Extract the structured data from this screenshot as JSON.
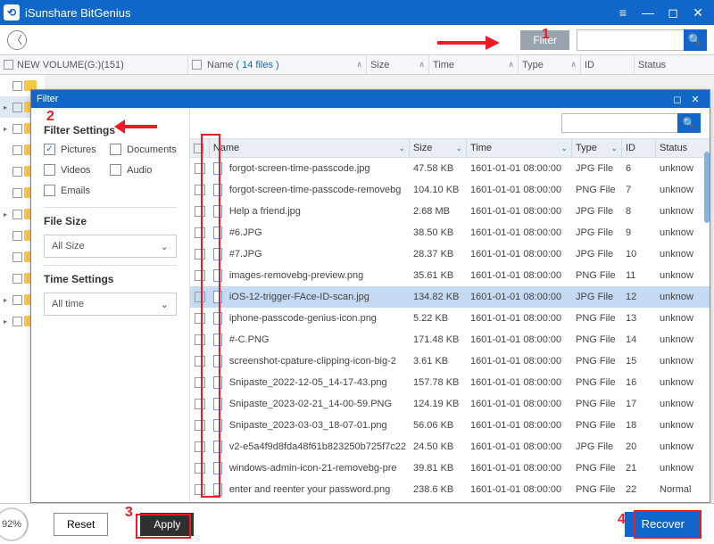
{
  "app_title": "iSunshare BitGenius",
  "topbar": {
    "filter_label": "Filter",
    "search_placeholder": ""
  },
  "main_header": {
    "volume": "NEW VOLUME(G:)(151)",
    "name_label": "Name",
    "name_count": "( 14 files )",
    "size": "Size",
    "time": "Time",
    "type": "Type",
    "id": "ID",
    "status": "Status"
  },
  "filter_panel": {
    "title": "Filter",
    "settings_heading": "Filter Settings",
    "types": {
      "pictures": "Pictures",
      "documents": "Documents",
      "videos": "Videos",
      "audio": "Audio",
      "emails": "Emails"
    },
    "file_size_heading": "File Size",
    "file_size_value": "All Size",
    "time_heading": "Time Settings",
    "time_value": "All time",
    "search_placeholder": "",
    "cols": {
      "name": "Name",
      "size": "Size",
      "time": "Time",
      "type": "Type",
      "id": "ID",
      "status": "Status"
    },
    "rows": [
      {
        "name": "forgot-screen-time-passcode.jpg",
        "size": "47.58 KB",
        "time": "1601-01-01 08:00:00",
        "type": "JPG File",
        "id": "6",
        "status": "unknow"
      },
      {
        "name": "forgot-screen-time-passcode-removebg",
        "size": "104.10 KB",
        "time": "1601-01-01 08:00:00",
        "type": "PNG File",
        "id": "7",
        "status": "unknow"
      },
      {
        "name": "Help a friend.jpg",
        "size": "2.68 MB",
        "time": "1601-01-01 08:00:00",
        "type": "JPG File",
        "id": "8",
        "status": "unknow"
      },
      {
        "name": "#6.JPG",
        "size": "38.50 KB",
        "time": "1601-01-01 08:00:00",
        "type": "JPG File",
        "id": "9",
        "status": "unknow"
      },
      {
        "name": "#7.JPG",
        "size": "28.37 KB",
        "time": "1601-01-01 08:00:00",
        "type": "JPG File",
        "id": "10",
        "status": "unknow"
      },
      {
        "name": "images-removebg-preview.png",
        "size": "35.61 KB",
        "time": "1601-01-01 08:00:00",
        "type": "PNG File",
        "id": "11",
        "status": "unknow"
      },
      {
        "name": "iOS-12-trigger-FAce-ID-scan.jpg",
        "size": "134.82 KB",
        "time": "1601-01-01 08:00:00",
        "type": "JPG File",
        "id": "12",
        "status": "unknow",
        "sel": true
      },
      {
        "name": "iphone-passcode-genius-icon.png",
        "size": "5.22 KB",
        "time": "1601-01-01 08:00:00",
        "type": "PNG File",
        "id": "13",
        "status": "unknow"
      },
      {
        "name": "#-C.PNG",
        "size": "171.48 KB",
        "time": "1601-01-01 08:00:00",
        "type": "PNG File",
        "id": "14",
        "status": "unknow"
      },
      {
        "name": "screenshot-cpature-clipping-icon-big-2",
        "size": "3.61 KB",
        "time": "1601-01-01 08:00:00",
        "type": "PNG File",
        "id": "15",
        "status": "unknow"
      },
      {
        "name": "Snipaste_2022-12-05_14-17-43.png",
        "size": "157.78 KB",
        "time": "1601-01-01 08:00:00",
        "type": "PNG File",
        "id": "16",
        "status": "unknow"
      },
      {
        "name": "Snipaste_2023-02-21_14-00-59.PNG",
        "size": "124.19 KB",
        "time": "1601-01-01 08:00:00",
        "type": "PNG File",
        "id": "17",
        "status": "unknow"
      },
      {
        "name": "Snipaste_2023-03-03_18-07-01.png",
        "size": "56.06 KB",
        "time": "1601-01-01 08:00:00",
        "type": "PNG File",
        "id": "18",
        "status": "unknow"
      },
      {
        "name": "v2-e5a4f9d8fda48f61b823250b725f7c22",
        "size": "24.50 KB",
        "time": "1601-01-01 08:00:00",
        "type": "JPG File",
        "id": "20",
        "status": "unknow"
      },
      {
        "name": "windows-admin-icon-21-removebg-pre",
        "size": "39.81 KB",
        "time": "1601-01-01 08:00:00",
        "type": "PNG File",
        "id": "21",
        "status": "unknow"
      },
      {
        "name": "enter and reenter your password.png",
        "size": "238.6 KB",
        "time": "1601-01-01 08:00:00",
        "type": "PNG File",
        "id": "22",
        "status": "Normal"
      }
    ]
  },
  "bottom": {
    "progress": "92%",
    "reset": "Reset",
    "apply": "Apply",
    "recover": "Recover"
  },
  "annotations": {
    "n1": "1",
    "n2": "2",
    "n3": "3",
    "n4": "4"
  }
}
